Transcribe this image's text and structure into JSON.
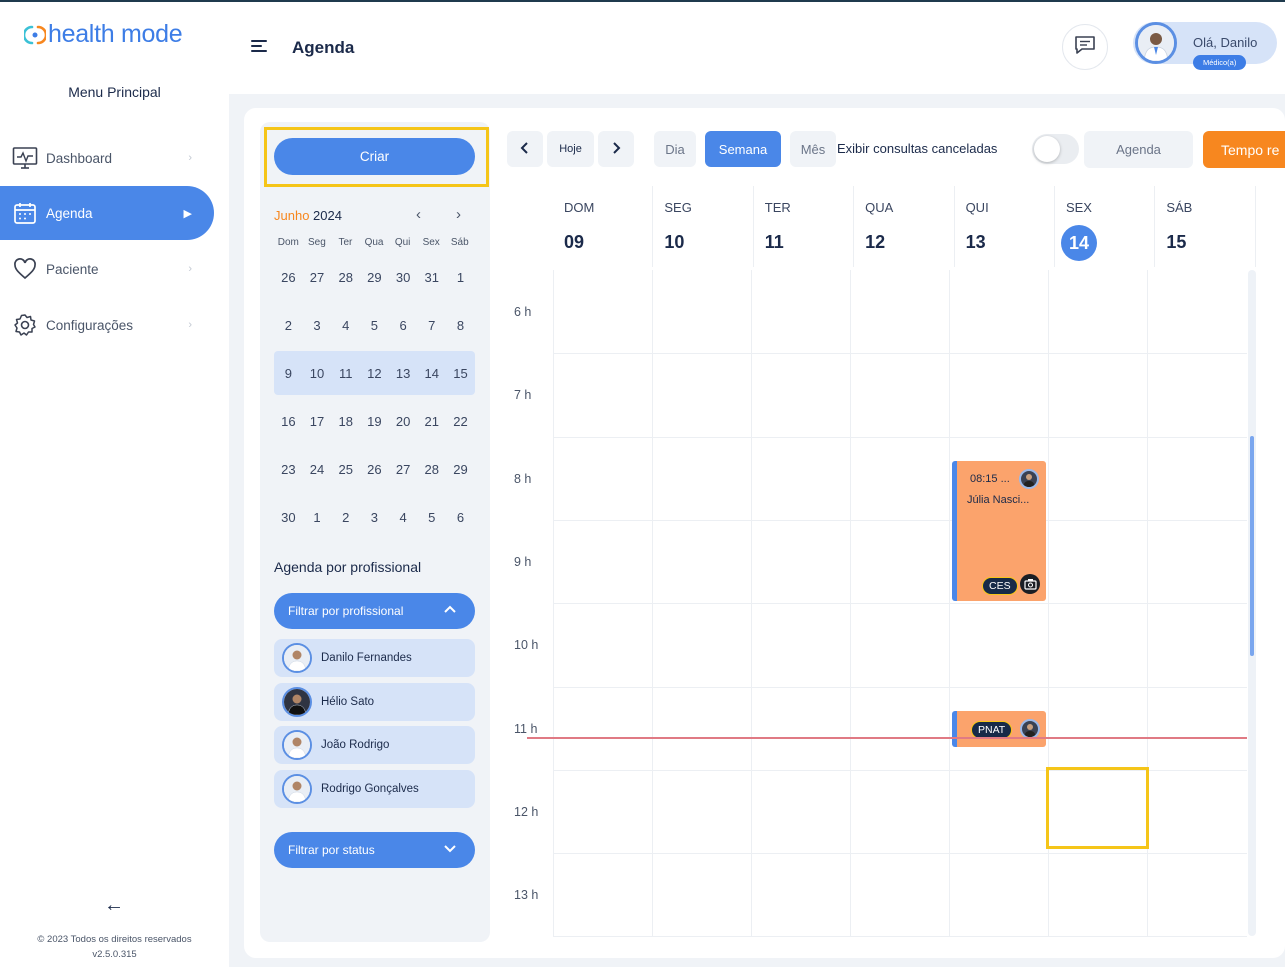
{
  "app": {
    "logo_text": "health mode",
    "menu_title": "Menu Principal",
    "nav": [
      {
        "label": "Dashboard",
        "icon": "monitor-icon"
      },
      {
        "label": "Agenda",
        "icon": "calendar-icon"
      },
      {
        "label": "Paciente",
        "icon": "heart-icon"
      },
      {
        "label": "Configurações",
        "icon": "gear-icon"
      }
    ],
    "footer_copyright": "© 2023 Todos os direitos reservados",
    "footer_version": "v2.5.0.315"
  },
  "header": {
    "title": "Agenda",
    "greeting": "Olá, Danilo",
    "role": "Médico(a)"
  },
  "sidebar_panel": {
    "create_label": "Criar",
    "mini_calendar": {
      "month": "Junho",
      "year": "2024",
      "weekdays": [
        "Dom",
        "Seg",
        "Ter",
        "Qua",
        "Qui",
        "Sex",
        "Sáb"
      ],
      "weeks": [
        [
          "26",
          "27",
          "28",
          "29",
          "30",
          "31",
          "1"
        ],
        [
          "2",
          "3",
          "4",
          "5",
          "6",
          "7",
          "8"
        ],
        [
          "9",
          "10",
          "11",
          "12",
          "13",
          "14",
          "15"
        ],
        [
          "16",
          "17",
          "18",
          "19",
          "20",
          "21",
          "22"
        ],
        [
          "23",
          "24",
          "25",
          "26",
          "27",
          "28",
          "29"
        ],
        [
          "30",
          "1",
          "2",
          "3",
          "4",
          "5",
          "6"
        ]
      ],
      "selected_week": 2
    },
    "prof_title": "Agenda por profissional",
    "filter_prof_label": "Filtrar por profissional",
    "professionals": [
      "Danilo Fernandes",
      "Hélio Sato",
      "João Rodrigo",
      "Rodrigo Gonçalves"
    ],
    "filter_status_label": "Filtrar por status"
  },
  "toolbar": {
    "today_label": "Hoje",
    "views": [
      "Dia",
      "Semana",
      "Mês"
    ],
    "active_view": "Semana",
    "show_cancelled_label": "Exibir consultas canceladas",
    "show_cancelled_on": false,
    "agenda_label": "Agenda",
    "tempo_label": "Tempo re"
  },
  "calendar": {
    "days": [
      {
        "name": "DOM",
        "num": "09"
      },
      {
        "name": "SEG",
        "num": "10"
      },
      {
        "name": "TER",
        "num": "11"
      },
      {
        "name": "QUA",
        "num": "12"
      },
      {
        "name": "QUI",
        "num": "13"
      },
      {
        "name": "SEX",
        "num": "14",
        "today": true
      },
      {
        "name": "SÁB",
        "num": "15"
      }
    ],
    "hours": [
      "6 h",
      "7 h",
      "8 h",
      "9 h",
      "10 h",
      "11 h",
      "12 h",
      "13 h"
    ],
    "events": [
      {
        "time": "08:15 ...",
        "patient": "Júlia Nasci...",
        "tag": "CES"
      },
      {
        "tag": "PNAT"
      }
    ],
    "colors": {
      "accent": "#4a87e8",
      "event": "#fba36c",
      "now_line": "#e07a84",
      "highlight": "#f5c518"
    }
  }
}
